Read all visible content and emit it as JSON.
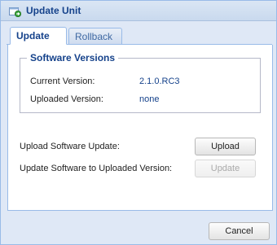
{
  "window": {
    "title": "Update Unit",
    "icon": "update-unit-icon"
  },
  "tabs": [
    {
      "label": "Update",
      "active": true
    },
    {
      "label": "Rollback",
      "active": false
    }
  ],
  "software_versions": {
    "legend": "Software Versions",
    "current_label": "Current Version:",
    "current_value": "2.1.0.RC3",
    "uploaded_label": "Uploaded Version:",
    "uploaded_value": "none"
  },
  "actions": {
    "upload_label": "Upload Software Update:",
    "upload_button": "Upload",
    "update_label": "Update Software to Uploaded Version:",
    "update_button": "Update"
  },
  "footer": {
    "cancel_button": "Cancel"
  },
  "colors": {
    "accent": "#15428b",
    "border": "#99bbe8",
    "background": "#dfe8f6"
  }
}
